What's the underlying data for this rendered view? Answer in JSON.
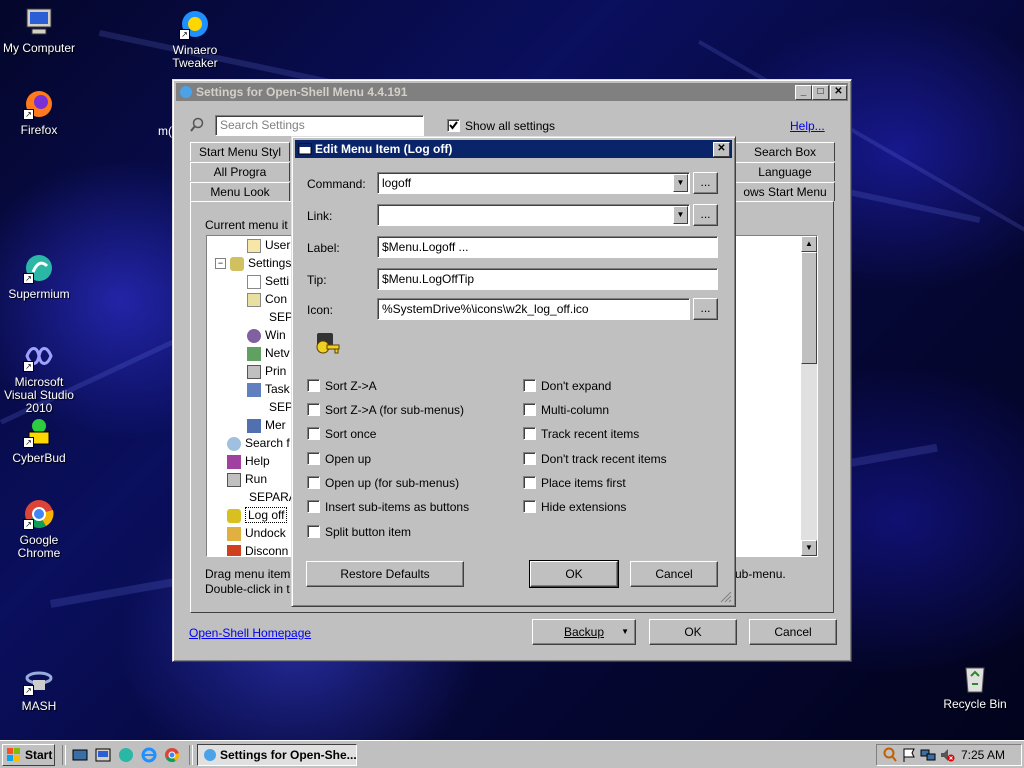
{
  "desktop": {
    "icons": [
      {
        "label": "My Computer",
        "icon": "computer-icon"
      },
      {
        "label": "Winaero Tweaker",
        "icon": "winaero-icon"
      },
      {
        "label": "Firefox",
        "icon": "firefox-icon"
      },
      {
        "label": "Supermium",
        "icon": "supermium-icon"
      },
      {
        "label": "Microsoft Visual Studio 2010",
        "icon": "visual-studio-icon"
      },
      {
        "label": "CyberBud",
        "icon": "cyberbud-icon"
      },
      {
        "label": "Google Chrome",
        "icon": "chrome-icon"
      },
      {
        "label": "MASH",
        "icon": "mash-icon"
      },
      {
        "label": "Recycle Bin",
        "icon": "recycle-bin-icon"
      }
    ],
    "partial_label": "m("
  },
  "settings_window": {
    "title": "Settings for Open-Shell Menu 4.4.191",
    "search_placeholder": "Search Settings",
    "show_all_label": "Show all settings",
    "show_all_checked": true,
    "help_link": "Help...",
    "tabs_row1": [
      "Start Menu Styl",
      "Search Box"
    ],
    "tabs_row2": [
      "All Progra",
      "Language"
    ],
    "tabs_row3": [
      "Menu Look",
      "ows Start Menu"
    ],
    "current_menu_label": "Current menu it",
    "tree": [
      "User",
      "Settings",
      "Setti",
      "Con",
      "SEPA",
      "Win",
      "Netv",
      "Prin",
      "Task",
      "SEPA",
      "Mer",
      "Search f",
      "Help",
      "Run",
      "SEPARA",
      "Log off",
      "Undock",
      "Disconn"
    ],
    "hint_line1": "Drag menu item",
    "hint_line1_right": "ub-menu.",
    "hint_line2": "Double-click in t",
    "homepage_link": "Open-Shell Homepage",
    "backup_button": "Backup",
    "ok_button": "OK",
    "cancel_button": "Cancel"
  },
  "edit_dialog": {
    "title": "Edit Menu Item (Log off)",
    "command_label": "Command:",
    "command_value": "logoff",
    "link_label": "Link:",
    "link_value": "",
    "label_label": "Label:",
    "label_value": "$Menu.Logoff ...",
    "tip_label": "Tip:",
    "tip_value": "$Menu.LogOffTip",
    "icon_label": "Icon:",
    "icon_value": "%SystemDrive%\\icons\\w2k_log_off.ico",
    "browse_label": "...",
    "checkboxes_left": [
      "Sort Z->A",
      "Sort Z->A (for sub-menus)",
      "Sort once",
      "Open up",
      "Open up (for sub-menus)",
      "Insert sub-items as buttons",
      "Split button item"
    ],
    "checkboxes_right": [
      "Don't expand",
      "Multi-column",
      "Track recent items",
      "Don't track recent items",
      "Place items first",
      "Hide extensions"
    ],
    "restore_button": "Restore Defaults",
    "ok_button": "OK",
    "cancel_button": "Cancel"
  },
  "taskbar": {
    "start_label": "Start",
    "task_label": "Settings for Open-She...",
    "clock": "7:25 AM"
  },
  "colors": {
    "title_active": "#0a246a",
    "title_inactive": "#808080",
    "face": "#c0c0c0",
    "selection": "#0a246a"
  }
}
